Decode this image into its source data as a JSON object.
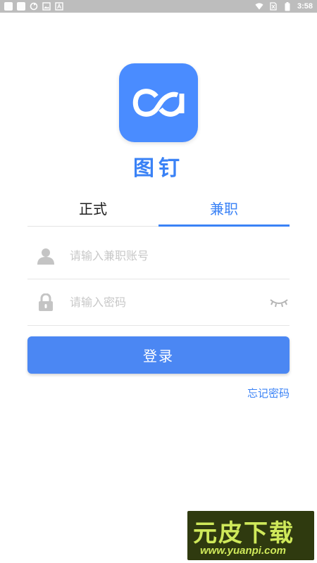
{
  "status_bar": {
    "time": "3:58",
    "left_icons": [
      "app-icon",
      "app-icon",
      "sync-icon",
      "image-icon",
      "font-icon"
    ],
    "right_icons": [
      "wifi-icon",
      "no-sim-icon",
      "battery-icon"
    ]
  },
  "app": {
    "name": "图钉",
    "logo_icon": "infinity-logo-icon",
    "brand_color": "#3a82f6"
  },
  "tabs": [
    {
      "label": "正式",
      "active": false
    },
    {
      "label": "兼职",
      "active": true
    }
  ],
  "form": {
    "account": {
      "placeholder": "请输入兼职账号",
      "value": "",
      "icon": "user-icon"
    },
    "password": {
      "placeholder": "请输入密码",
      "value": "",
      "icon": "lock-icon",
      "toggle_icon": "eye-closed-icon"
    },
    "login_label": "登录",
    "forgot_label": "忘记密码"
  },
  "watermark": {
    "title": "元皮下载",
    "url": "www.yuanpi.com"
  }
}
